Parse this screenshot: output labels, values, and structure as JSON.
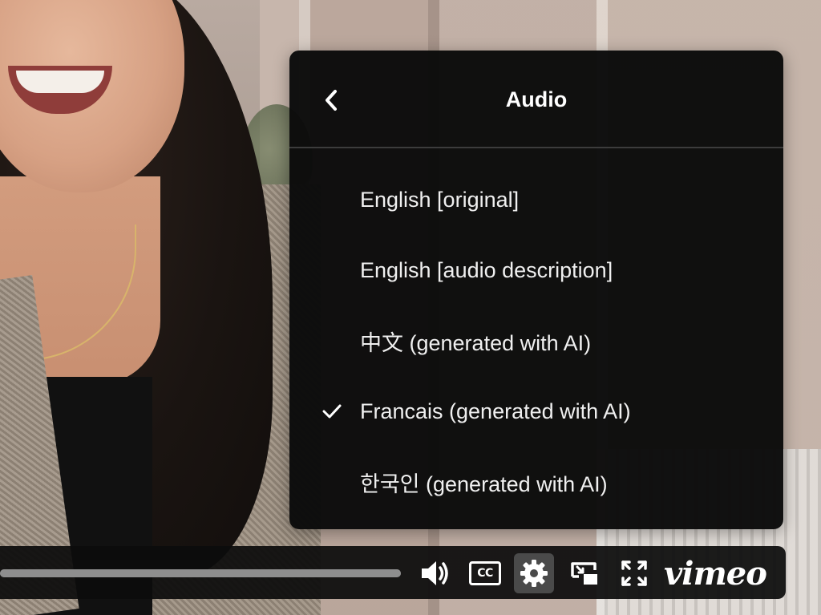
{
  "menu": {
    "title": "Audio",
    "items": [
      {
        "label": "English [original]",
        "selected": false
      },
      {
        "label": "English [audio description]",
        "selected": false
      },
      {
        "label": "中文 (generated with AI)",
        "selected": false
      },
      {
        "label": "Francais (generated with AI)",
        "selected": true
      },
      {
        "label": "한국인 (generated with AI)",
        "selected": false
      }
    ]
  },
  "controls": {
    "progress": 1.0,
    "cc_label": "CC",
    "logo": "vimeo",
    "active_button": "settings",
    "icons": [
      "volume-icon",
      "closed-captions-icon",
      "settings-gear-icon",
      "picture-in-picture-icon",
      "fullscreen-icon"
    ]
  },
  "colors": {
    "menu_background": "#0a0a0a",
    "menu_text": "#f0f0f0",
    "divider": "#3c3c3c",
    "active_button": "#4a4a4a",
    "progress_track": "#6f6f6f"
  }
}
